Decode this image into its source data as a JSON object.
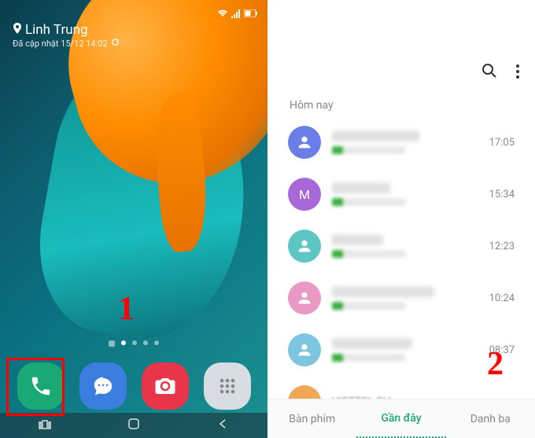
{
  "left": {
    "location": {
      "name": "Linh Trung",
      "updated": "Đã cập nhật 15/12 14:02"
    },
    "annotation": "1",
    "dock": {
      "phone": "phone-icon",
      "messages": "messages-icon",
      "camera": "camera-icon",
      "apps": "apps-icon"
    }
  },
  "right": {
    "section_today": "Hôm nay",
    "annotation": "2",
    "calls": [
      {
        "time": "17:05",
        "avatar_letter": ""
      },
      {
        "time": "15:34",
        "avatar_letter": "M"
      },
      {
        "time": "12:23",
        "avatar_letter": ""
      },
      {
        "time": "10:24",
        "avatar_letter": ""
      },
      {
        "time": "08:37",
        "avatar_letter": ""
      },
      {
        "time": "",
        "avatar_letter": "",
        "name_visible": "VIETTEL DV"
      }
    ],
    "tabs": {
      "keypad": "Bàn phím",
      "recent": "Gần đây",
      "contacts": "Danh bạ"
    }
  }
}
